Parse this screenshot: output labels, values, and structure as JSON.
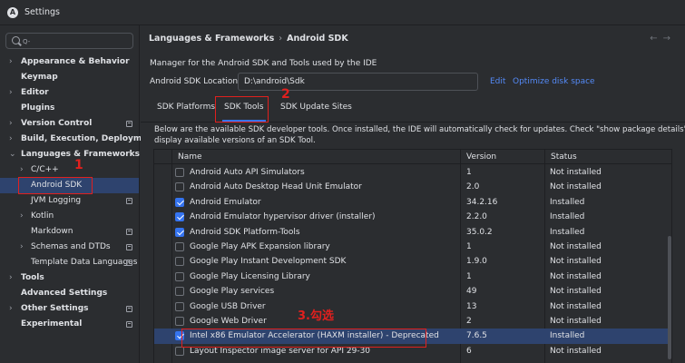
{
  "window": {
    "title": "Settings",
    "app_icon": "android-studio-icon"
  },
  "sidebar": {
    "search": {
      "placeholder": "Q-"
    },
    "items": [
      {
        "label": "Appearance & Behavior",
        "level": 0,
        "expandable": true,
        "bold": true
      },
      {
        "label": "Keymap",
        "level": 0,
        "expandable": false,
        "bold": true
      },
      {
        "label": "Editor",
        "level": 0,
        "expandable": true,
        "bold": true
      },
      {
        "label": "Plugins",
        "level": 0,
        "expandable": false,
        "bold": true
      },
      {
        "label": "Version Control",
        "level": 0,
        "expandable": true,
        "bold": true,
        "pinned": true
      },
      {
        "label": "Build, Execution, Deployment",
        "level": 0,
        "expandable": true,
        "bold": true
      },
      {
        "label": "Languages & Frameworks",
        "level": 0,
        "expandable": true,
        "expanded": true,
        "bold": true
      },
      {
        "label": "C/C++",
        "level": 1,
        "expandable": true
      },
      {
        "label": "Android SDK",
        "level": 1,
        "expandable": false,
        "selected": true
      },
      {
        "label": "JVM Logging",
        "level": 1,
        "expandable": false,
        "pinned": true
      },
      {
        "label": "Kotlin",
        "level": 1,
        "expandable": true
      },
      {
        "label": "Markdown",
        "level": 1,
        "expandable": false,
        "pinned": true
      },
      {
        "label": "Schemas and DTDs",
        "level": 1,
        "expandable": true,
        "pinned": true
      },
      {
        "label": "Template Data Languages",
        "level": 1,
        "expandable": false,
        "pinned": true
      },
      {
        "label": "Tools",
        "level": 0,
        "expandable": true,
        "bold": true
      },
      {
        "label": "Advanced Settings",
        "level": 0,
        "expandable": false,
        "bold": true
      },
      {
        "label": "Other Settings",
        "level": 0,
        "expandable": true,
        "bold": true,
        "pinned": true
      },
      {
        "label": "Experimental",
        "level": 0,
        "expandable": false,
        "bold": true,
        "pinned": true
      }
    ]
  },
  "main": {
    "breadcrumb": [
      "Languages & Frameworks",
      "Android SDK"
    ],
    "breadcrumb_sep": "›",
    "nav_back": "←",
    "nav_forward": "→",
    "description": "Manager for the Android SDK and Tools used by the IDE",
    "sdk_location_label": "Android SDK Location:",
    "sdk_location_value": "D:\\android\\Sdk",
    "edit_link": "Edit",
    "optimize_link": "Optimize disk space",
    "tabs": [
      {
        "label": "SDK Platforms",
        "active": false
      },
      {
        "label": "SDK Tools",
        "active": true
      },
      {
        "label": "SDK Update Sites",
        "active": false
      }
    ],
    "info_line1": "Below are the available SDK developer tools. Once installed, the IDE will automatically check for updates. Check \"show package details\" to",
    "info_line2": "display available versions of an SDK Tool.",
    "table": {
      "columns": [
        "Name",
        "Version",
        "Status"
      ],
      "rows": [
        {
          "name": "Android Auto API Simulators",
          "version": "1",
          "status": "Not installed",
          "checked": false
        },
        {
          "name": "Android Auto Desktop Head Unit Emulator",
          "version": "2.0",
          "status": "Not installed",
          "checked": false
        },
        {
          "name": "Android Emulator",
          "version": "34.2.16",
          "status": "Installed",
          "checked": true
        },
        {
          "name": "Android Emulator hypervisor driver (installer)",
          "version": "2.2.0",
          "status": "Installed",
          "checked": true
        },
        {
          "name": "Android SDK Platform-Tools",
          "version": "35.0.2",
          "status": "Installed",
          "checked": true
        },
        {
          "name": "Google Play APK Expansion library",
          "version": "1",
          "status": "Not installed",
          "checked": false
        },
        {
          "name": "Google Play Instant Development SDK",
          "version": "1.9.0",
          "status": "Not installed",
          "checked": false
        },
        {
          "name": "Google Play Licensing Library",
          "version": "1",
          "status": "Not installed",
          "checked": false
        },
        {
          "name": "Google Play services",
          "version": "49",
          "status": "Not installed",
          "checked": false
        },
        {
          "name": "Google USB Driver",
          "version": "13",
          "status": "Not installed",
          "checked": false
        },
        {
          "name": "Google Web Driver",
          "version": "2",
          "status": "Not installed",
          "checked": false
        },
        {
          "name": "Intel x86 Emulator Accelerator (HAXM installer) - Deprecated",
          "version": "7.6.5",
          "status": "Installed",
          "checked": true,
          "selected": true
        },
        {
          "name": "Layout Inspector image server for API 29-30",
          "version": "6",
          "status": "Not installed",
          "checked": false
        }
      ]
    }
  },
  "annotations": {
    "step1": "1",
    "step2": "2",
    "step3": "3.勾选",
    "color": "#e0201e"
  }
}
